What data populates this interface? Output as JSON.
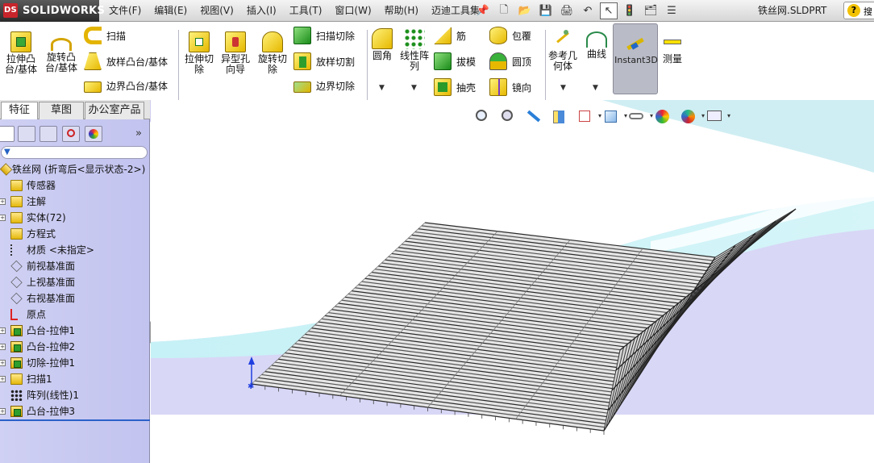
{
  "app": {
    "brand": "SOLIDWORKS",
    "brand_prefix": "DS",
    "window_title": "铁丝网.SLDPRT",
    "help_short": "搜"
  },
  "menu": [
    "文件(F)",
    "编辑(E)",
    "视图(V)",
    "插入(I)",
    "工具(T)",
    "窗口(W)",
    "帮助(H)",
    "迈迪工具集"
  ],
  "ribbon": {
    "extrude_boss": "拉伸凸\n台/基体",
    "revolve_boss": "旋转凸\n台/基体",
    "sweep": "扫描",
    "loft_boss": "放样凸台/基体",
    "boundary_boss": "边界凸台/基体",
    "extrude_cut": "拉伸切\n除",
    "hole_wizard": "异型孔\n向导",
    "revolve_cut": "旋转切\n除",
    "sweep_cut": "扫描切除",
    "loft_cut": "放样切割",
    "boundary_cut": "边界切除",
    "fillet": "圆角",
    "linear_pattern": "线性阵\n列",
    "rib": "筋",
    "draft": "拔模",
    "shell": "抽壳",
    "wrap": "包覆",
    "dome": "圆顶",
    "mirror": "镜向",
    "ref_geometry": "参考几\n何体",
    "curves": "曲线",
    "instant3d": "Instant3D",
    "measure": "测量"
  },
  "tabs": [
    "特征",
    "草图",
    "办公室产品"
  ],
  "tree": {
    "root": "铁丝网  (折弯后<显示状态-2>)",
    "nodes": [
      {
        "label": "传感器",
        "icon": "sensor-icon",
        "exp": false
      },
      {
        "label": "注解",
        "icon": "annotation-icon",
        "exp": true
      },
      {
        "label": "实体(72)",
        "icon": "solid-bodies-icon",
        "exp": true
      },
      {
        "label": "方程式",
        "icon": "equation-icon",
        "exp": false
      },
      {
        "label": "材质 <未指定>",
        "icon": "material-icon",
        "exp": false
      },
      {
        "label": "前视基准面",
        "icon": "plane-icon",
        "exp": false
      },
      {
        "label": "上视基准面",
        "icon": "plane-icon",
        "exp": false
      },
      {
        "label": "右视基准面",
        "icon": "plane-icon",
        "exp": false
      },
      {
        "label": "原点",
        "icon": "origin-icon",
        "exp": false
      },
      {
        "label": "凸台-拉伸1",
        "icon": "extrude-icon",
        "exp": true
      },
      {
        "label": "凸台-拉伸2",
        "icon": "extrude-icon",
        "exp": true
      },
      {
        "label": "切除-拉伸1",
        "icon": "cut-extrude-icon",
        "exp": true
      },
      {
        "label": "扫描1",
        "icon": "sweep-icon",
        "exp": true
      },
      {
        "label": "阵列(线性)1",
        "icon": "pattern-icon",
        "exp": false
      },
      {
        "label": "凸台-拉伸3",
        "icon": "extrude-icon",
        "exp": true
      }
    ]
  },
  "colors": {
    "fm_bg": "#c8c9f1",
    "ribbon_lower": "#cfcdf0",
    "wire": "#3a3a3a",
    "sky": "#c9f0f4"
  }
}
